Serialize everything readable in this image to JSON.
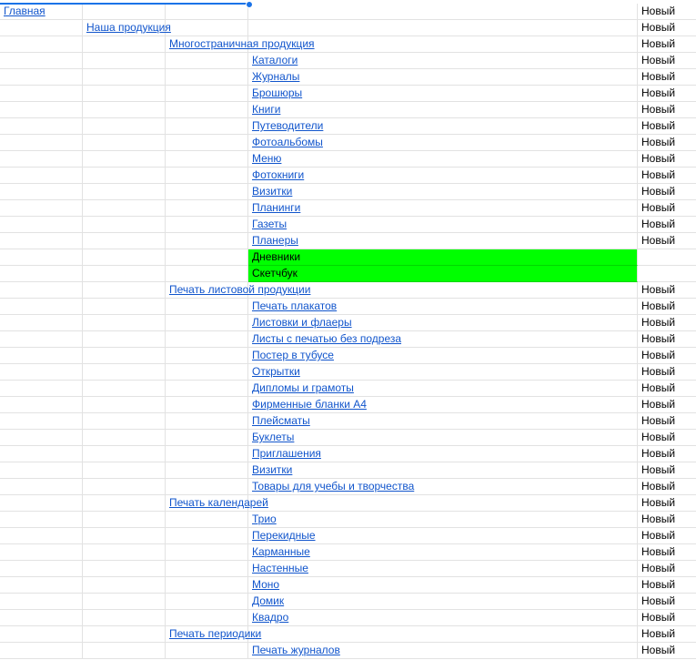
{
  "status_default": "Новый",
  "colors": {
    "link": "#1155cc",
    "highlight": "#00ff00",
    "selection": "#1a73e8",
    "grid": "#e2e2e2"
  },
  "rows": [
    {
      "level": 0,
      "label": "Главная",
      "status": "Новый"
    },
    {
      "level": 1,
      "label": "Наша продукция",
      "status": "Новый"
    },
    {
      "level": 2,
      "label": "Многостраничная продукция",
      "status": "Новый"
    },
    {
      "level": 3,
      "label": "Каталоги",
      "status": "Новый"
    },
    {
      "level": 3,
      "label": "Журналы",
      "status": "Новый"
    },
    {
      "level": 3,
      "label": "Брошюры",
      "status": "Новый"
    },
    {
      "level": 3,
      "label": "Книги",
      "status": "Новый"
    },
    {
      "level": 3,
      "label": "Путеводители",
      "status": "Новый"
    },
    {
      "level": 3,
      "label": "Фотоальбомы",
      "status": "Новый"
    },
    {
      "level": 3,
      "label": "Меню",
      "status": "Новый"
    },
    {
      "level": 3,
      "label": "Фотокниги",
      "status": "Новый"
    },
    {
      "level": 3,
      "label": "Визитки",
      "status": "Новый"
    },
    {
      "level": 3,
      "label": "Планинги",
      "status": "Новый"
    },
    {
      "level": 3,
      "label": "Газеты",
      "status": "Новый"
    },
    {
      "level": 3,
      "label": "Планеры",
      "status": "Новый"
    },
    {
      "level": 3,
      "label": "Дневники",
      "status": "",
      "highlight": true
    },
    {
      "level": 3,
      "label": "Скетчбук",
      "status": "",
      "highlight": true
    },
    {
      "level": 2,
      "label": "Печать листовой продукции",
      "status": "Новый"
    },
    {
      "level": 3,
      "label": "Печать плакатов",
      "status": "Новый"
    },
    {
      "level": 3,
      "label": "Листовки и флаеры",
      "status": "Новый"
    },
    {
      "level": 3,
      "label": "Листы с печатью без подреза",
      "status": "Новый"
    },
    {
      "level": 3,
      "label": "Постер в тубусе",
      "status": "Новый"
    },
    {
      "level": 3,
      "label": "Открытки",
      "status": "Новый"
    },
    {
      "level": 3,
      "label": "Дипломы и грамоты",
      "status": "Новый"
    },
    {
      "level": 3,
      "label": "Фирменные бланки А4",
      "status": "Новый"
    },
    {
      "level": 3,
      "label": "Плейсматы",
      "status": "Новый"
    },
    {
      "level": 3,
      "label": "Буклеты",
      "status": "Новый"
    },
    {
      "level": 3,
      "label": "Приглашения",
      "status": "Новый"
    },
    {
      "level": 3,
      "label": "Визитки",
      "status": "Новый"
    },
    {
      "level": 3,
      "label": "Товары для учебы и творчества",
      "status": "Новый"
    },
    {
      "level": 2,
      "label": "Печать календарей",
      "status": "Новый"
    },
    {
      "level": 3,
      "label": "Трио",
      "status": "Новый"
    },
    {
      "level": 3,
      "label": "Перекидные",
      "status": "Новый"
    },
    {
      "level": 3,
      "label": "Карманные",
      "status": "Новый"
    },
    {
      "level": 3,
      "label": "Настенные",
      "status": "Новый"
    },
    {
      "level": 3,
      "label": "Моно",
      "status": "Новый"
    },
    {
      "level": 3,
      "label": "Домик",
      "status": "Новый"
    },
    {
      "level": 3,
      "label": "Квадро",
      "status": "Новый"
    },
    {
      "level": 2,
      "label": "Печать периодики",
      "status": "Новый"
    },
    {
      "level": 3,
      "label": "Печать журналов",
      "status": "Новый"
    }
  ]
}
